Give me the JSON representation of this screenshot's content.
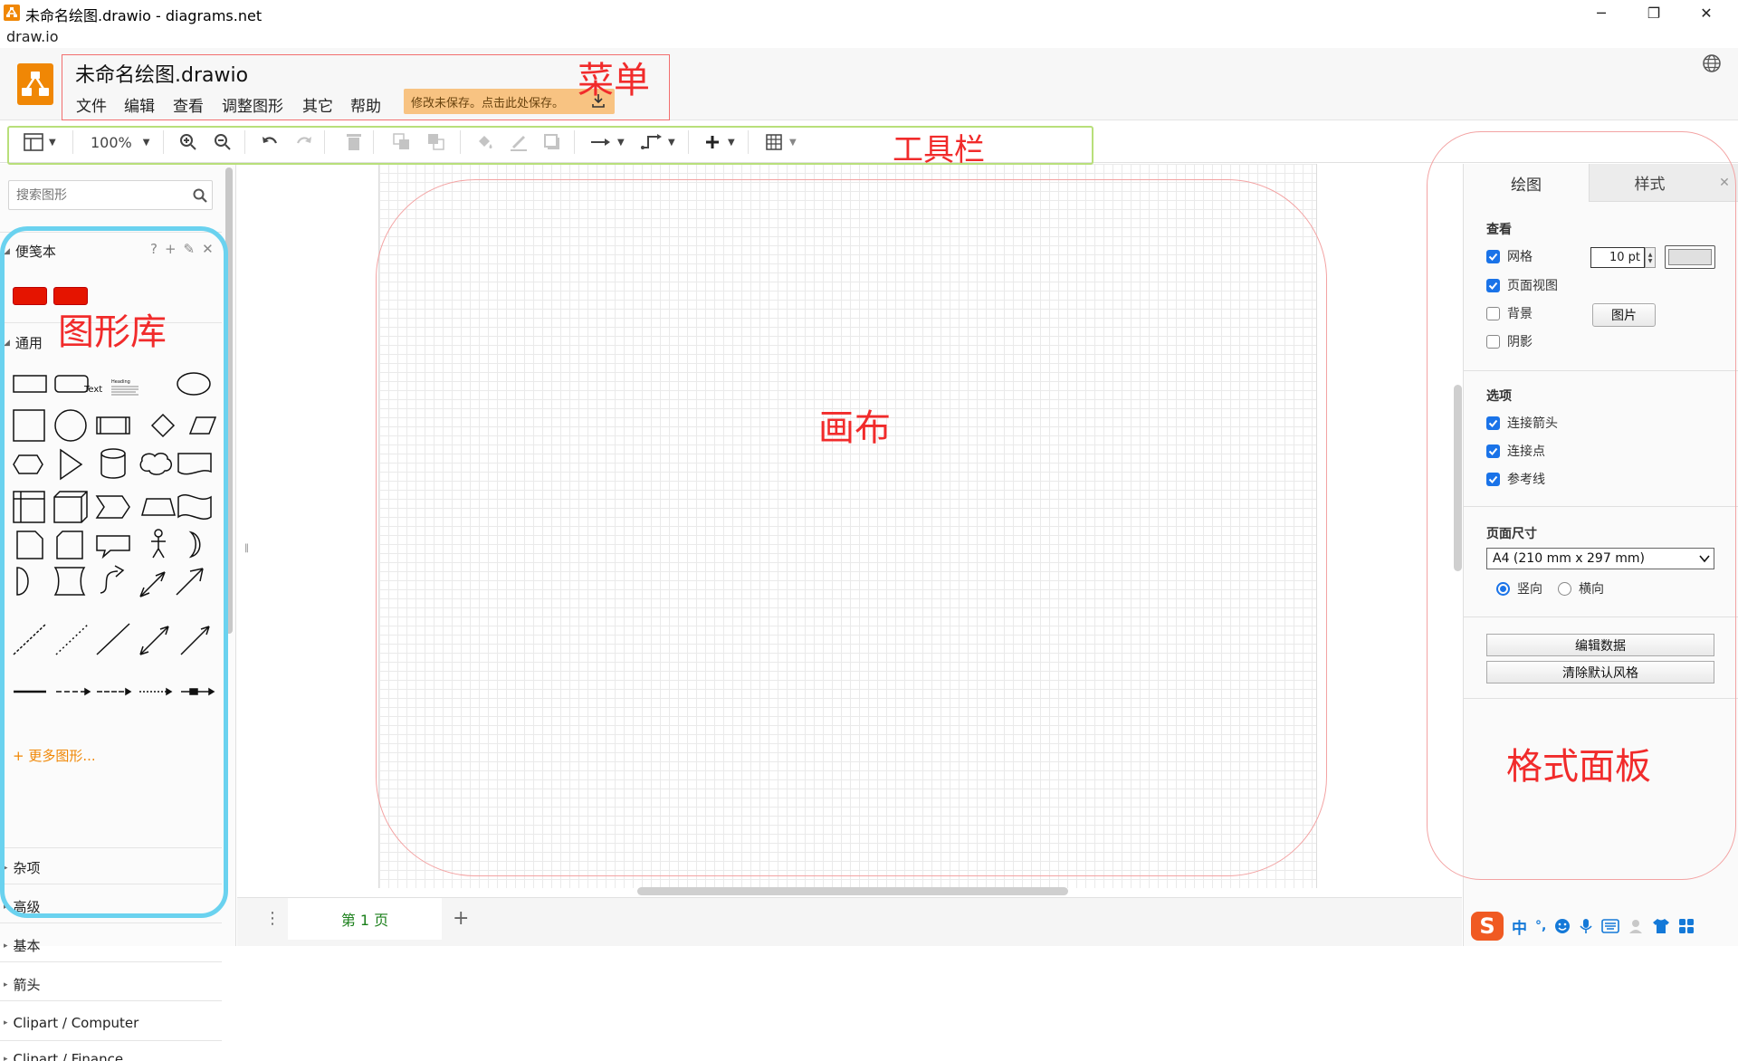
{
  "window": {
    "title": "未命名绘图.drawio - diagrams.net",
    "app_name": "draw.io",
    "minimize": "─",
    "restore": "❐",
    "close": "✕"
  },
  "header": {
    "doc_title": "未命名绘图.drawio",
    "menus": [
      "文件",
      "编辑",
      "查看",
      "调整图形",
      "其它",
      "帮助"
    ],
    "save_notice": "修改未保存。点击此处保存。"
  },
  "toolbar": {
    "zoom": "100%"
  },
  "left_panel": {
    "search_placeholder": "搜索图形",
    "scratchpad": "便笺本",
    "general": "通用",
    "text_shape": "Text",
    "heading_shape": "Heading",
    "sections": [
      "杂项",
      "高级",
      "基本",
      "箭头",
      "Clipart / Computer",
      "Clipart / Finance"
    ],
    "more_shapes": "+ 更多图形..."
  },
  "pages": {
    "current": "第 1 页",
    "add": "+",
    "menu": "⋮"
  },
  "right_panel": {
    "tab_diagram": "绘图",
    "tab_style": "样式",
    "view_label": "查看",
    "grid": "网格",
    "grid_size": "10 pt",
    "page_view": "页面视图",
    "background": "背景",
    "image_button": "图片",
    "shadow": "阴影",
    "options_label": "选项",
    "connection_arrows": "连接箭头",
    "connection_points": "连接点",
    "guides": "参考线",
    "page_size_label": "页面尺寸",
    "page_size": "A4 (210 mm x 297 mm)",
    "portrait": "竖向",
    "landscape": "横向",
    "edit_data": "编辑数据",
    "clear_default_style": "清除默认风格"
  },
  "annotations": {
    "menu": "菜单",
    "toolbar": "工具栏",
    "shape_library": "图形库",
    "canvas": "画布",
    "format_panel": "格式面板"
  },
  "ime": {
    "chinese": "中",
    "punct": "°,"
  },
  "colors": {
    "accent": "#f08705",
    "annotation_red": "#f12b2b",
    "library_box": "#6ad2ef",
    "toolbar_box": "#b8df7a",
    "checkbox": "#1a73e8"
  }
}
